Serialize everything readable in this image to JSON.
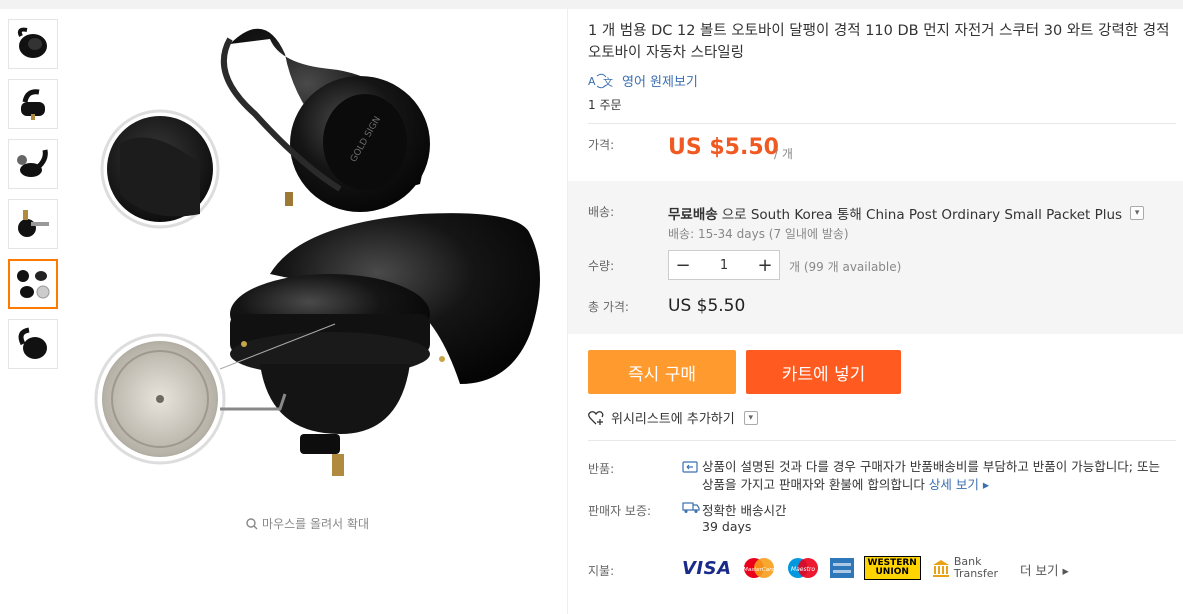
{
  "product": {
    "title": "1 개 범용 DC 12 볼트 오토바이 달팽이 경적 110 DB 먼지 자전거 스쿠터 30 와트 강력한 경적 오토바이 자동차 스타일링",
    "translate_label": "영어 원제보기",
    "orders": "1 주문"
  },
  "gallery": {
    "zoom_hint": "마우스를 올려서 확대",
    "thumbnails": [
      {
        "icon": "horn-top-view"
      },
      {
        "icon": "horn-side-view"
      },
      {
        "icon": "horn-angle-view"
      },
      {
        "icon": "horn-bracket-view"
      },
      {
        "icon": "horn-detail-view",
        "active": true
      },
      {
        "icon": "horn-back-view"
      }
    ],
    "image_labels": {
      "stamp": "GOLD SIGN"
    }
  },
  "price": {
    "label": "가격:",
    "value": "US $5.50",
    "unit": "/ 개"
  },
  "shipping": {
    "label": "배송:",
    "free": "무료배송",
    "route": "으로 South Korea 통해 China Post Ordinary Small Packet Plus",
    "eta": "배송: 15-34 days (7 일내에 발송)"
  },
  "quantity": {
    "label": "수량:",
    "value": "1",
    "minus": "−",
    "plus": "+",
    "available": "개 (99 개 available)"
  },
  "total": {
    "label": "총 가격:",
    "value": "US $5.50"
  },
  "actions": {
    "buy_now": "즉시 구매",
    "add_to_cart": "카트에 넣기",
    "wishlist": "위시리스트에 추가하기"
  },
  "returns": {
    "label": "반품:",
    "text": "상품이 설명된 것과 다를 경우 구매자가 반품배송비를 부담하고 반품이 가능합니다; 또는 상품을 가지고 판매자와 환불에 합의합니다",
    "more": "상세 보기"
  },
  "guarantee": {
    "label": "판매자 보증:",
    "title": "정확한 배송시간",
    "days": "39 days"
  },
  "payment": {
    "label": "지불:",
    "visa": "VISA",
    "mastercard": "MasterCard",
    "maestro": "Maestro",
    "wu_line1": "WESTERN",
    "wu_line2": "UNION",
    "bank_line1": "Bank",
    "bank_line2": "Transfer",
    "more": "더 보기"
  },
  "colors": {
    "accent_orange": "#ff9a2e",
    "cart_orange": "#ff5a1f",
    "price_red": "#f05a22",
    "link_blue": "#3a6fb0"
  }
}
